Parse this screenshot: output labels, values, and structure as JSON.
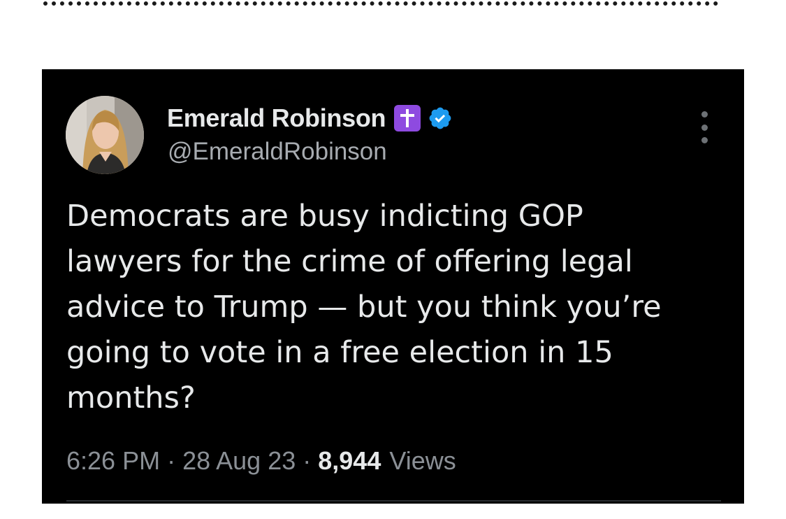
{
  "tweet": {
    "author": {
      "display_name": "Emerald Robinson",
      "handle": "@EmeraldRobinson",
      "badges": [
        "latin-cross-icon",
        "verified-badge-icon"
      ]
    },
    "text_lines": [
      "Democrats are busy indicting GOP",
      "lawyers for the crime of offering legal",
      "advice to Trump — but you think you’re",
      "going to vote in a free election in 15",
      "months?"
    ],
    "meta": {
      "time": "6:26 PM",
      "separator": "·",
      "date": "28 Aug 23",
      "views_count": "8,944",
      "views_label": "Views"
    }
  },
  "colors": {
    "card_background": "#000000",
    "primary_text": "#e7e9ea",
    "secondary_text": "#8b9096",
    "verified_blue": "#1d9bf0",
    "cross_badge_purple": "#8e4ae0"
  }
}
